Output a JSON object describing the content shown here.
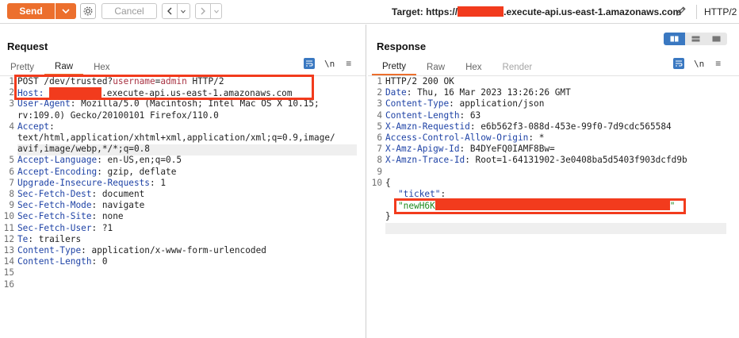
{
  "toolbar": {
    "send_label": "Send",
    "cancel_label": "Cancel",
    "target_prefix": "Target: https://",
    "target_suffix": ".execute-api.us-east-1.amazonaws.com",
    "http_version": "HTTP/2"
  },
  "request": {
    "title": "Request",
    "tabs": [
      "Pretty",
      "Raw",
      "Hex"
    ],
    "active_tab": "Raw",
    "newline_toggle": "\\n",
    "menu": "≡",
    "line_numbers": [
      "1",
      "2",
      "3",
      "",
      "4",
      "",
      "",
      "5",
      "6",
      "7",
      "8",
      "9",
      "10",
      "11",
      "12",
      "13",
      "14",
      "15",
      "16"
    ],
    "lines": {
      "l1_method_path": "POST /dev/trusted?",
      "l1_param": "username",
      "l1_eq": "=",
      "l1_value": "admin",
      "l1_proto": " HTTP/2",
      "l2_key": "Host:",
      "l2_value": ".execute-api.us-east-1.amazonaws.com",
      "l3_key": "User-Agent",
      "l3_value": ": Mozilla/5.0 (Macintosh; Intel Mac OS X 10.15;",
      "l3_cont": "rv:109.0) Gecko/20100101 Firefox/110.0",
      "l4_key": "Accept",
      "l4_value": ":",
      "l4_cont1": "text/html,application/xhtml+xml,application/xml;q=0.9,image/",
      "l4_cont2": "avif,image/webp,*/*;q=0.8",
      "l5_key": "Accept-Language",
      "l5_value": ": en-US,en;q=0.5",
      "l6_key": "Accept-Encoding",
      "l6_value": ": gzip, deflate",
      "l7_key": "Upgrade-Insecure-Requests",
      "l7_value": ": 1",
      "l8_key": "Sec-Fetch-Dest",
      "l8_value": ": document",
      "l9_key": "Sec-Fetch-Mode",
      "l9_value": ": navigate",
      "l10_key": "Sec-Fetch-Site",
      "l10_value": ": none",
      "l11_key": "Sec-Fetch-User",
      "l11_value": ": ?1",
      "l12_key": "Te",
      "l12_value": ": trailers",
      "l13_key": "Content-Type",
      "l13_value": ": application/x-www-form-urlencoded",
      "l14_key": "Content-Length",
      "l14_value": ": 0"
    }
  },
  "response": {
    "title": "Response",
    "tabs": [
      "Pretty",
      "Raw",
      "Hex",
      "Render"
    ],
    "active_tab": "Pretty",
    "newline_toggle": "\\n",
    "menu": "≡",
    "line_numbers": [
      "1",
      "2",
      "3",
      "4",
      "5",
      "6",
      "7",
      "8",
      "9",
      "10",
      "",
      "",
      ""
    ],
    "lines": {
      "l1": "HTTP/2 200 OK",
      "l2_key": "Date",
      "l2_value": ": Thu, 16 Mar 2023 13:26:26 GMT",
      "l3_key": "Content-Type",
      "l3_value": ": application/json",
      "l4_key": "Content-Length",
      "l4_value": ": 63",
      "l5_key": "X-Amzn-Requestid",
      "l5_value": ": e6b562f3-088d-453e-99f0-7d9cdc565584",
      "l6_key": "Access-Control-Allow-Origin",
      "l6_value": ": *",
      "l7_key": "X-Amz-Apigw-Id",
      "l7_value": ": B4DYeFQ0IAMF8Bw=",
      "l8_key": "X-Amzn-Trace-Id",
      "l8_value": ": Root=1-64131902-3e0408ba5d5403f903dcfd9b",
      "l10_open": "{",
      "json_key": "\"ticket\"",
      "json_colon": ":",
      "json_value_start": "\"newH6K",
      "json_value_end": "\"",
      "l10_close": "}"
    }
  },
  "colors": {
    "accent_orange": "#ec6f2d",
    "redaction_red": "#f23b1d",
    "header_key_blue": "#1f43a6",
    "json_string_green": "#228b22"
  }
}
